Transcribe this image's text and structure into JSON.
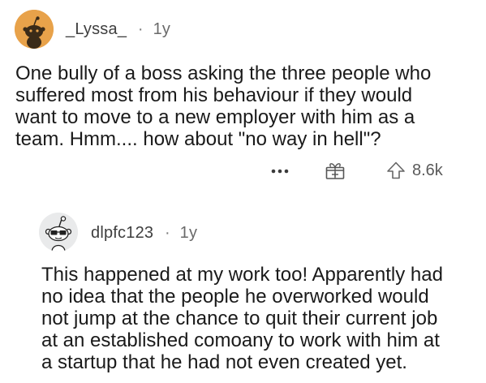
{
  "comments": [
    {
      "username": "_Lyssa_",
      "age": "1y",
      "text": "One bully of a boss asking the three people who\nsuffered most from his behaviour if they would\nwant to move to a new employer with him as a\nteam. Hmm.... how about \"no way in hell\"?",
      "score": "8.6k",
      "avatar_icon": "snoo-avatar-icon"
    },
    {
      "username": "dlpfc123",
      "age": "1y",
      "text": "This happened at my work too! Apparently had\nno idea that the people he overworked would\nnot jump at the chance to quit their current job\nat an established comoany to work with him at\na startup that he had not even created yet.",
      "avatar_icon": "snoo-avatar-glasses-icon"
    }
  ],
  "separator": "·",
  "actions": {
    "more_icon": "more-options-icon",
    "award_icon": "award-gift-icon",
    "upvote_icon": "upvote-arrow-icon"
  },
  "colors": {
    "text": "#1a1a1a",
    "meta": "#4a4a4a",
    "avatar_orange": "#e8a24a",
    "avatar_bg": "#e9eaeb"
  }
}
